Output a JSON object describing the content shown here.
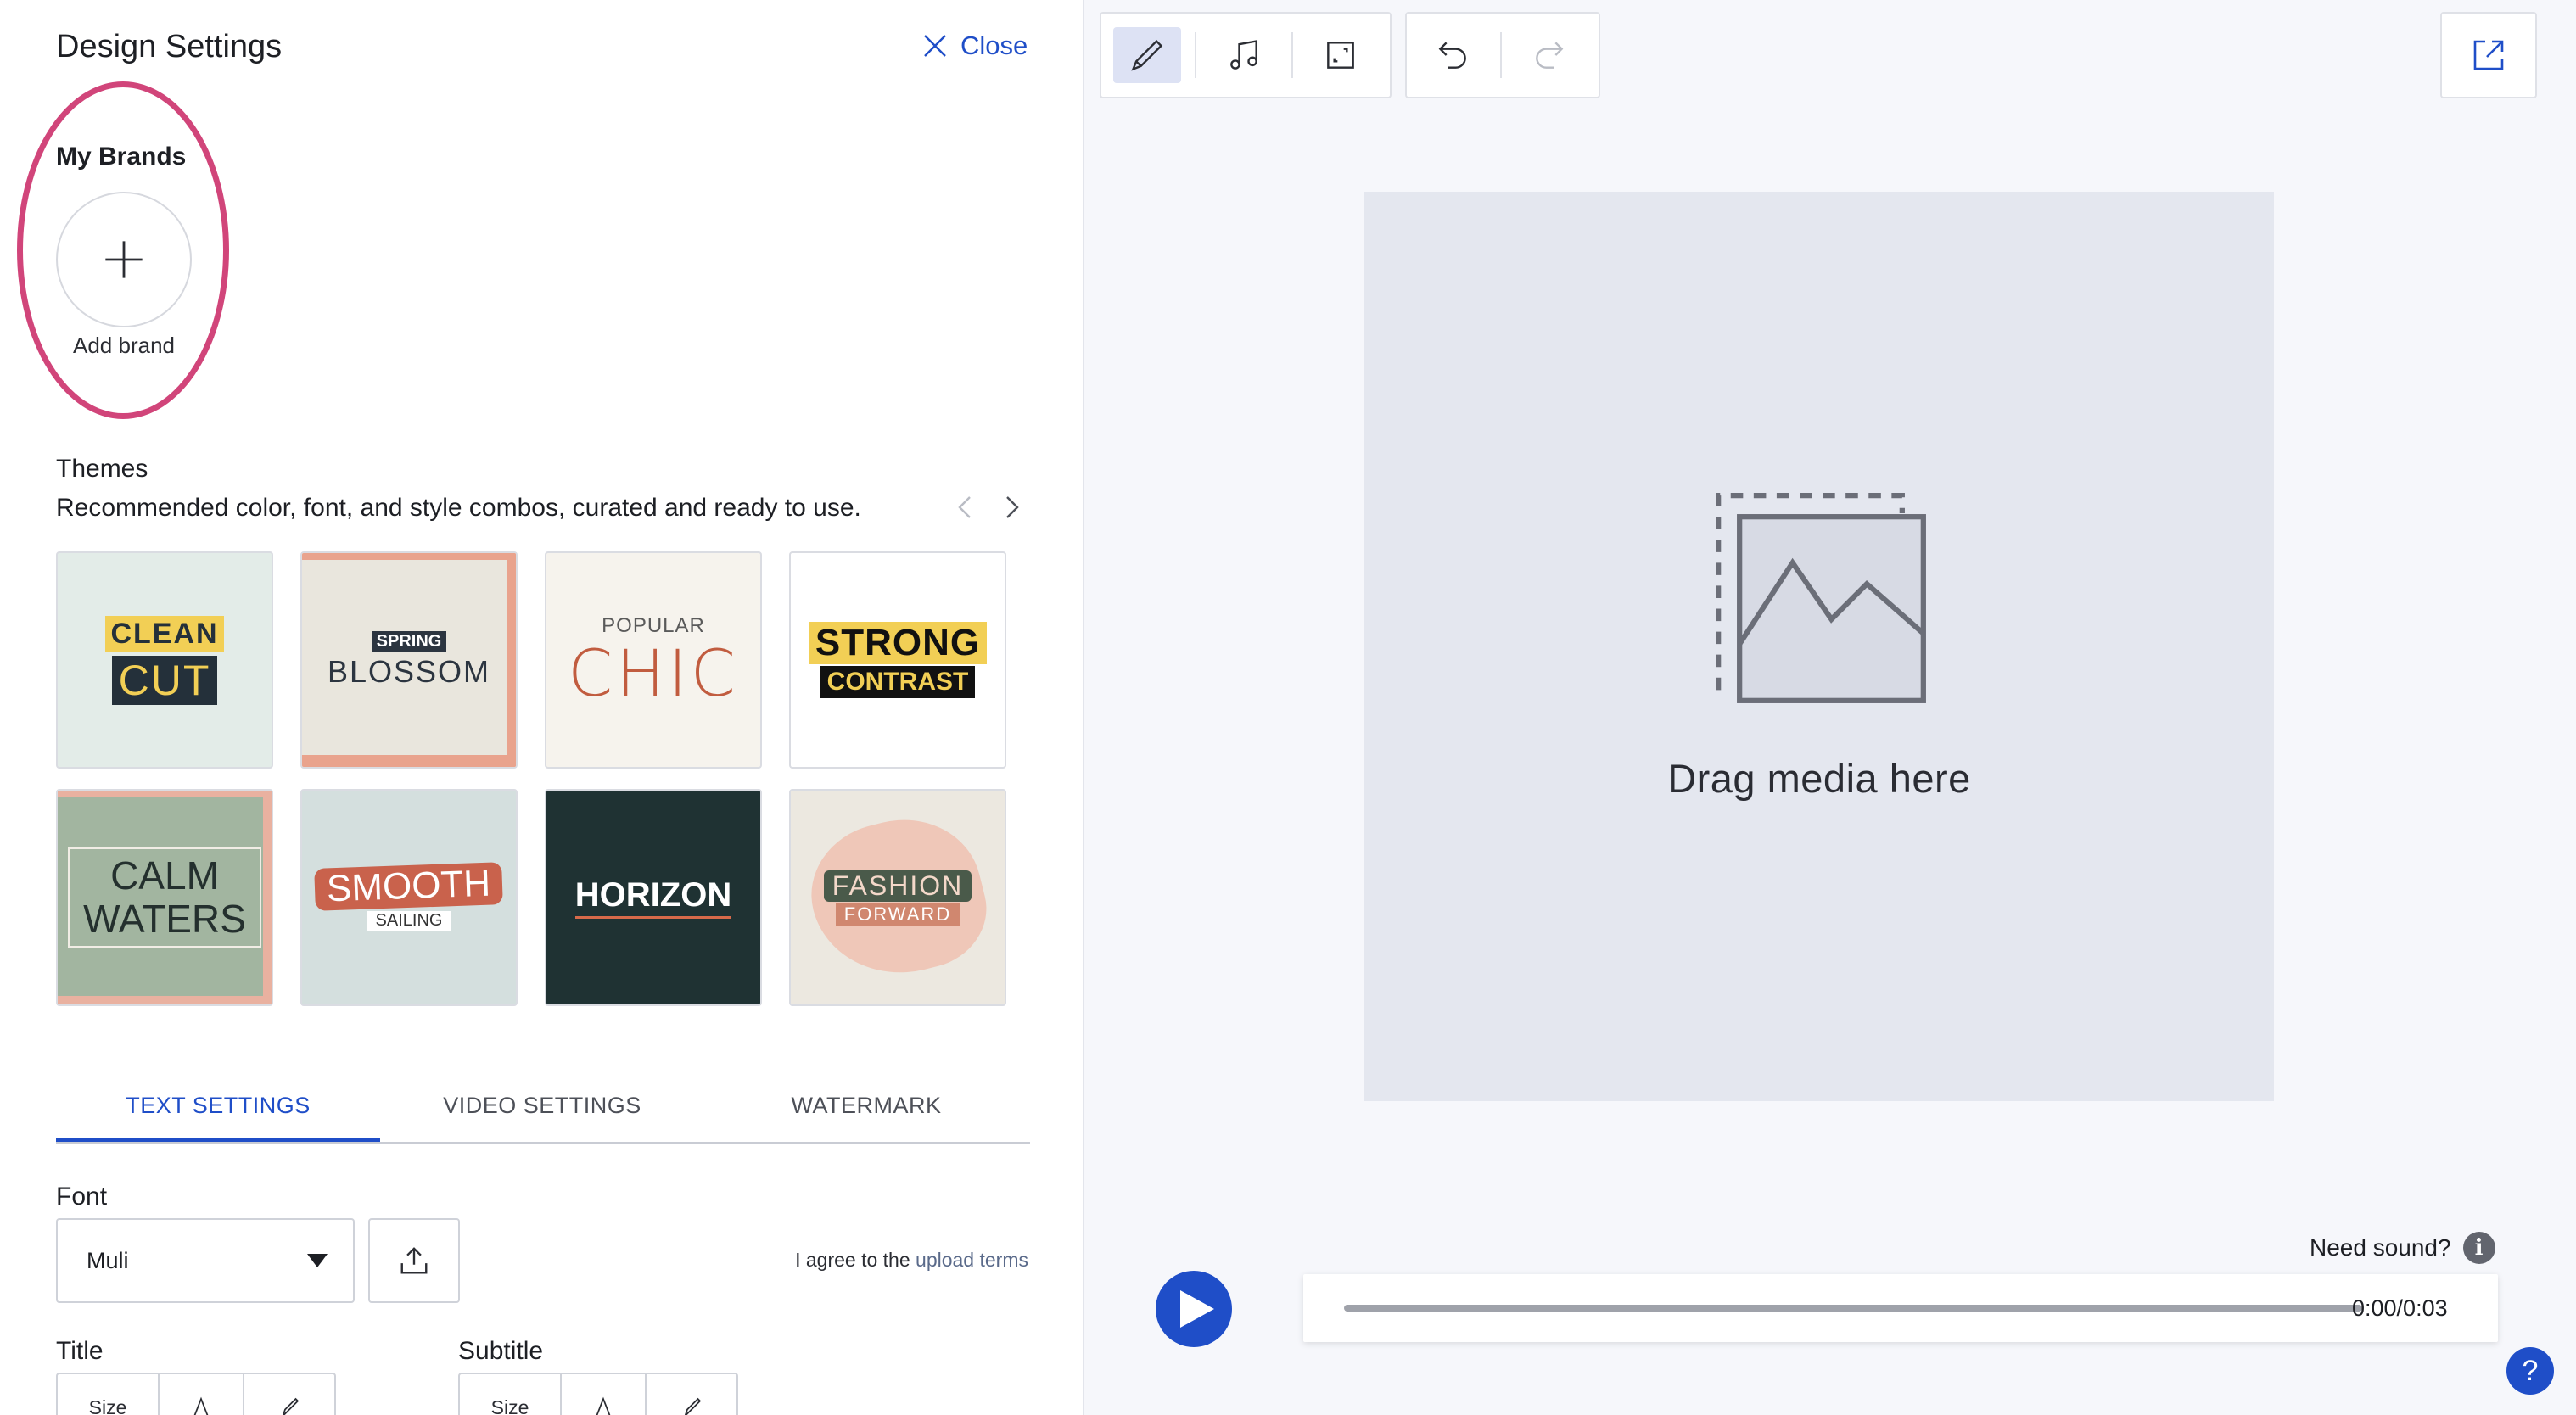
{
  "panel": {
    "title": "Design Settings",
    "close_label": "Close",
    "brands": {
      "label": "My Brands",
      "add_label": "Add brand"
    },
    "themes": {
      "label": "Themes",
      "description": "Recommended color, font, and style combos, curated and ready to use.",
      "items": [
        {
          "line1": "CLEAN",
          "line2": "CUT"
        },
        {
          "line1": "SPRING",
          "line2": "BLOSSOM"
        },
        {
          "line1": "POPULAR",
          "line2": "CHIC"
        },
        {
          "line1": "STRONG",
          "line2": "CONTRAST"
        },
        {
          "line1": "CALM",
          "line2": "WATERS"
        },
        {
          "line1": "SMOOTH",
          "line2": "SAILING"
        },
        {
          "line1": "HORIZON",
          "line2": ""
        },
        {
          "line1": "FASHION",
          "line2": "FORWARD"
        }
      ]
    },
    "tabs": [
      "TEXT SETTINGS",
      "VIDEO SETTINGS",
      "WATERMARK"
    ],
    "active_tab": "TEXT SETTINGS",
    "font": {
      "label": "Font",
      "value": "Muli",
      "agree_prefix": "I agree to the",
      "agree_link": "upload terms"
    },
    "title_label": "Title",
    "subtitle_label": "Subtitle",
    "size_label": "Size"
  },
  "toolbar": {
    "icons": [
      "brush-icon",
      "music-note-icon",
      "resize-icon",
      "undo-icon",
      "redo-icon",
      "export-icon"
    ]
  },
  "canvas": {
    "drop_text": "Drag media here"
  },
  "player": {
    "need_sound": "Need sound?",
    "info_glyph": "i",
    "time": "0:00/0:03",
    "help_glyph": "?"
  },
  "colors": {
    "accent": "#1f4ec8",
    "highlight": "#d1457a"
  }
}
